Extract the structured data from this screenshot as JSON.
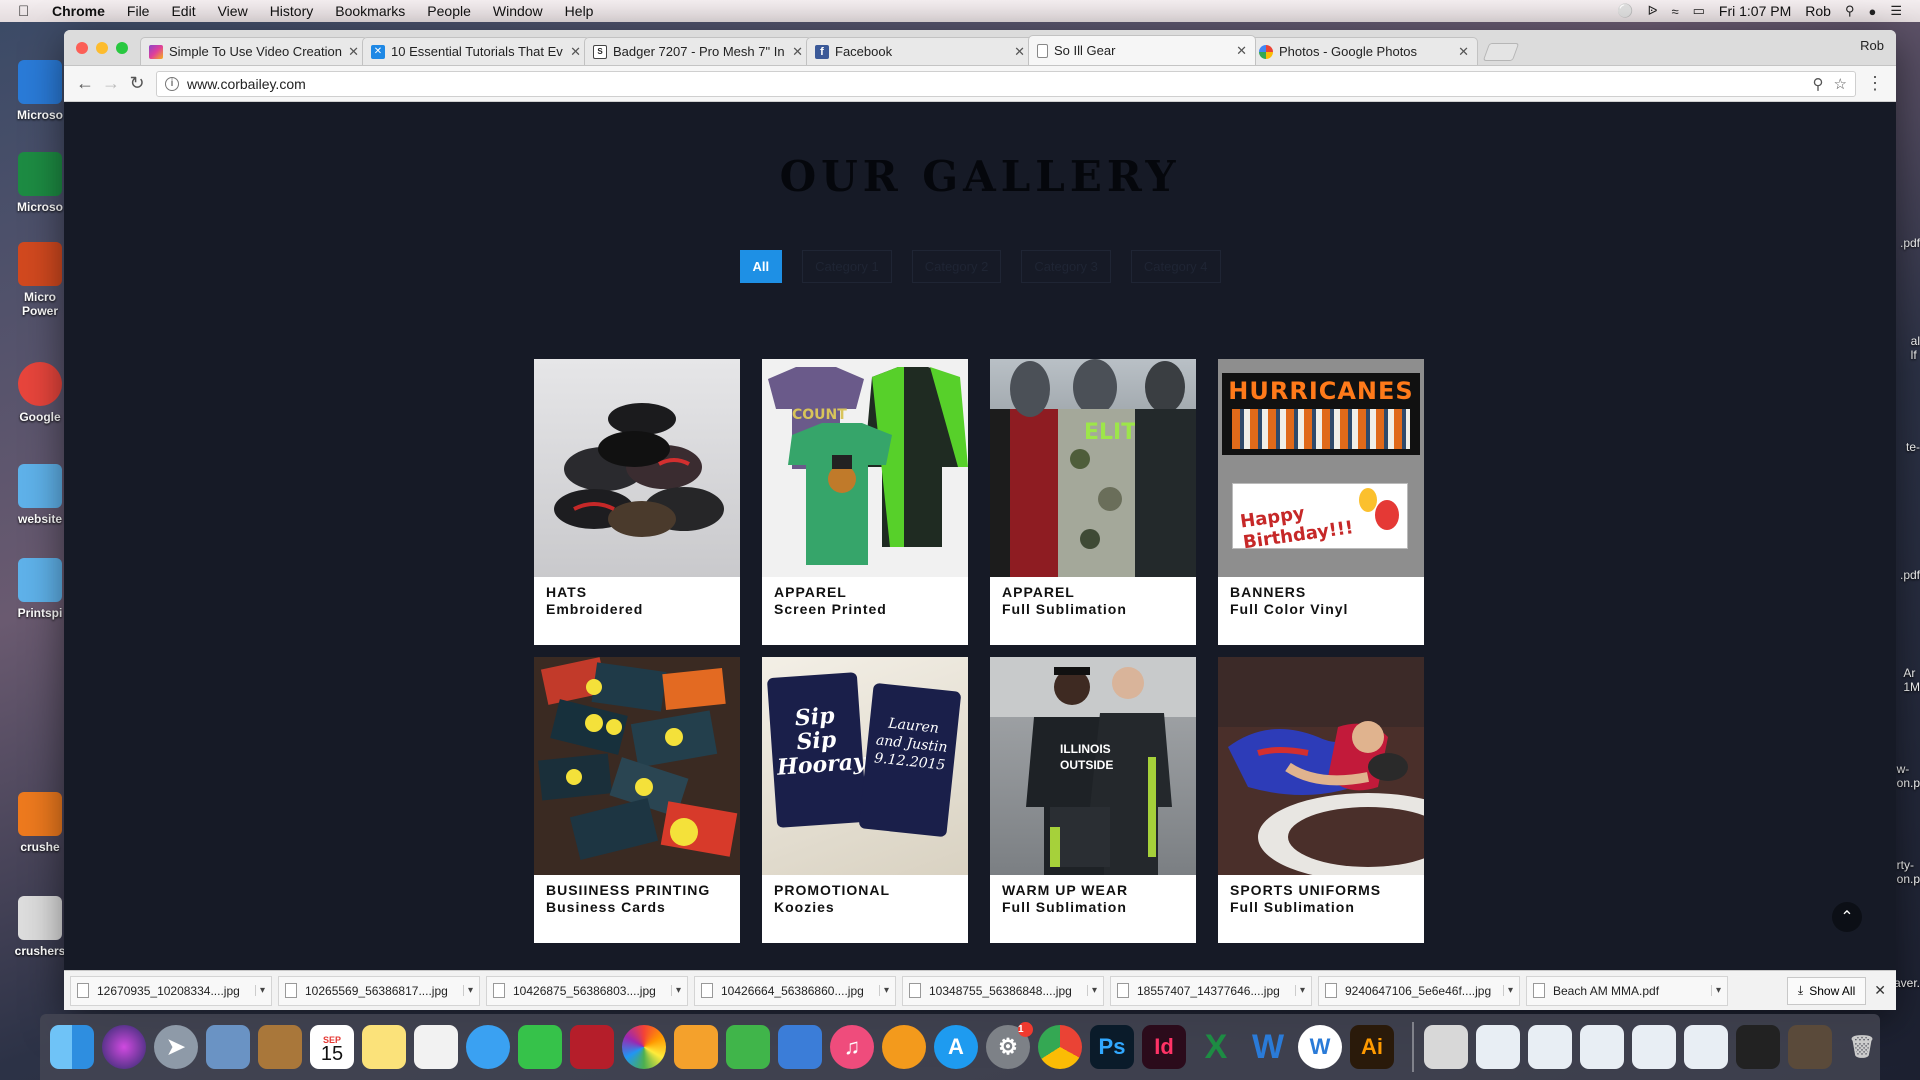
{
  "menubar": {
    "app": "Chrome",
    "items": [
      "File",
      "Edit",
      "View",
      "History",
      "Bookmarks",
      "People",
      "Window",
      "Help"
    ],
    "clock": "Fri 1:07 PM",
    "user": "Rob"
  },
  "desktop": {
    "left_icons": [
      "Microso",
      "Microso",
      "Micro\nPower",
      "Google",
      "website",
      "Printspi",
      "crushe",
      "crushers"
    ],
    "right_labels": [
      ".pdf",
      "al\nlf",
      "te-",
      ".pdf",
      "Ar\n1M",
      "w-\non.p",
      "rty-\non.p",
      "aver."
    ]
  },
  "browser": {
    "tabs": [
      {
        "title": "Simple To Use Video Creation",
        "icon": "multicolor-icon",
        "color": "#8b45c8"
      },
      {
        "title": "10 Essential Tutorials That Ev",
        "icon": "x-logo-icon",
        "color": "#1e88e5"
      },
      {
        "title": "Badger 7207 - Pro Mesh 7\" In",
        "icon": "ss-logo-icon",
        "color": "#444444"
      },
      {
        "title": "Facebook",
        "icon": "facebook-icon",
        "color": "#3b5998"
      },
      {
        "title": "So Ill Gear",
        "icon": "document-icon",
        "color": "#999999"
      },
      {
        "title": "Photos - Google Photos",
        "icon": "pinwheel-icon",
        "color": "#f4b400"
      }
    ],
    "profile": "Rob",
    "url": "www.corbailey.com"
  },
  "page": {
    "title": "OUR GALLERY",
    "filters": [
      "All",
      "Category 1",
      "Category 2",
      "Category 3",
      "Category 4"
    ],
    "cards": [
      {
        "label1": "HATS",
        "label2": "Embroidered",
        "img": "hats"
      },
      {
        "label1": "APPAREL",
        "label2": "Screen Printed",
        "img": "tees"
      },
      {
        "label1": "APPAREL",
        "label2": "Full Sublimation",
        "img": "jerseys"
      },
      {
        "label1": "BANNERS",
        "label2": "Full Color Vinyl",
        "img": "banners",
        "banner_title": "HURRICANES",
        "banner_sub": "Happy Birthday!!!"
      },
      {
        "label1": "BUSIINESS PRINTING",
        "label2": "Business Cards",
        "img": "cards"
      },
      {
        "label1": "PROMOTIONAL",
        "label2": "Koozies",
        "img": "koozies",
        "kz1": "Sip Sip Hooray!",
        "kz2": "Lauren and Justin 9.12.2015"
      },
      {
        "label1": "WARM UP WEAR",
        "label2": "Full Sublimation",
        "img": "warmup",
        "shirt_text": "ILLINOIS OUTSIDE"
      },
      {
        "label1": "SPORTS UNIFORMS",
        "label2": "Full Sublimation",
        "img": "wrestling"
      }
    ]
  },
  "downloads": {
    "items": [
      "12670935_10208334....jpg",
      "10265569_56386817....jpg",
      "10426875_56386803....jpg",
      "10426664_56386860....jpg",
      "10348755_56386848....jpg",
      "18557407_14377646....jpg",
      "9240647106_5e6e46f....jpg",
      "Beach AM MMA.pdf"
    ],
    "show_all": "Show All"
  },
  "dock": {
    "calendar_month": "SEP",
    "calendar_day": "15",
    "apps": [
      "finder",
      "siri",
      "launchpad",
      "preview",
      "contacts",
      "calendar",
      "notes",
      "reminders",
      "messages",
      "facetime",
      "photo-booth",
      "photos",
      "pages",
      "numbers",
      "keynote",
      "itunes",
      "ibooks",
      "app-store",
      "system-preferences",
      "chrome",
      "photoshop",
      "indesign",
      "excel",
      "word",
      "wunderlist",
      "illustrator"
    ],
    "badge": "1"
  }
}
